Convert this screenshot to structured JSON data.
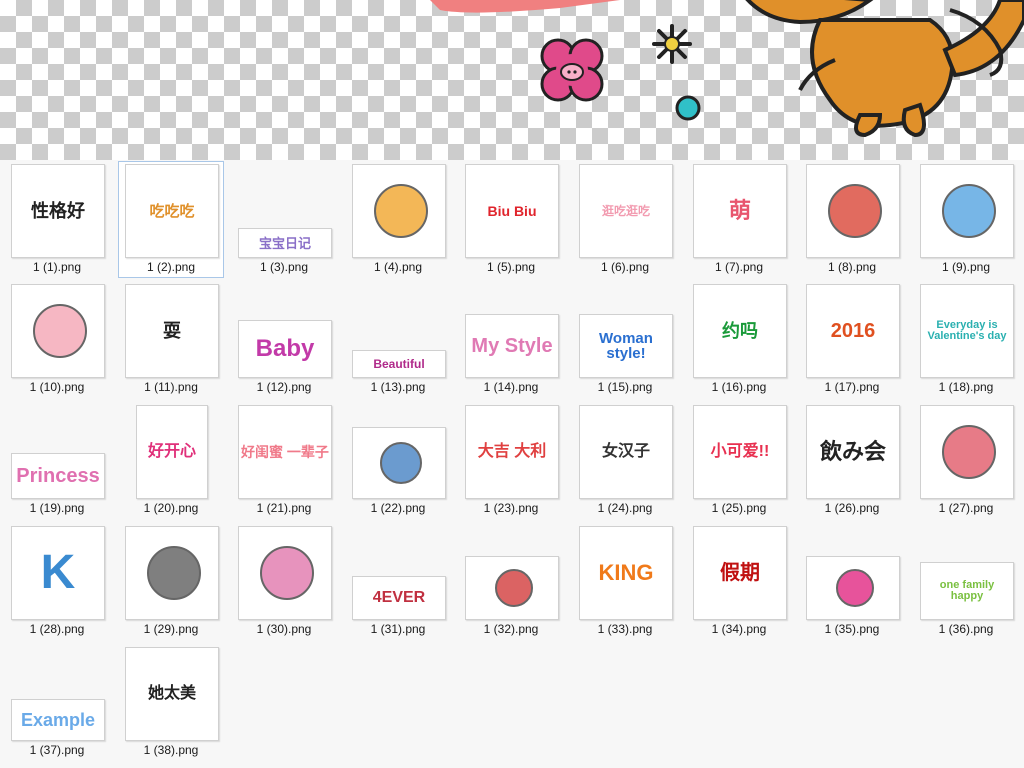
{
  "files": [
    {
      "name": "1 (1).png",
      "art": "性格好",
      "color": "#222222"
    },
    {
      "name": "1 (2).png",
      "art": "吃吃吃",
      "color": "#e0902a",
      "selected": true
    },
    {
      "name": "1 (3).png",
      "art": "宝宝日记",
      "color": "#8a6fc8"
    },
    {
      "name": "1 (4).png",
      "art": "",
      "color": "#f0a020"
    },
    {
      "name": "1 (5).png",
      "art": "Biu Biu",
      "color": "#e0242c"
    },
    {
      "name": "1 (6).png",
      "art": "逛吃逛吃",
      "color": "#f29bb0"
    },
    {
      "name": "1 (7).png",
      "art": "萌",
      "color": "#e8566e"
    },
    {
      "name": "1 (8).png",
      "art": "",
      "color": "#d83a2a"
    },
    {
      "name": "1 (9).png",
      "art": "",
      "color": "#4a9ee0"
    },
    {
      "name": "1 (10).png",
      "art": "",
      "color": "#f3a0b0"
    },
    {
      "name": "1 (11).png",
      "art": "耍",
      "color": "#222222"
    },
    {
      "name": "1 (12).png",
      "art": "Baby",
      "color": "#c23aa8"
    },
    {
      "name": "1 (13).png",
      "art": "Beautiful",
      "color": "#b02a8a"
    },
    {
      "name": "1 (14).png",
      "art": "My Style",
      "color": "#e07ab4"
    },
    {
      "name": "1 (15).png",
      "art": "Woman style!",
      "color": "#2a6fd0"
    },
    {
      "name": "1 (16).png",
      "art": "约吗",
      "color": "#1a9a3a"
    },
    {
      "name": "1 (17).png",
      "art": "2016",
      "color": "#e05020"
    },
    {
      "name": "1 (18).png",
      "art": "Everyday is Valentine's day",
      "color": "#2ab0b0"
    },
    {
      "name": "1 (19).png",
      "art": "Princess",
      "color": "#e070b0"
    },
    {
      "name": "1 (20).png",
      "art": "好开心",
      "color": "#e0307a"
    },
    {
      "name": "1 (21).png",
      "art": "好闺蜜 一辈子",
      "color": "#f07a8a"
    },
    {
      "name": "1 (22).png",
      "art": "",
      "color": "#3a7ac0"
    },
    {
      "name": "1 (23).png",
      "art": "大吉 大利",
      "color": "#e04040"
    },
    {
      "name": "1 (24).png",
      "art": "女汉子",
      "color": "#333333"
    },
    {
      "name": "1 (25).png",
      "art": "小可爱!!",
      "color": "#e83050"
    },
    {
      "name": "1 (26).png",
      "art": "飲み会",
      "color": "#222222"
    },
    {
      "name": "1 (27).png",
      "art": "",
      "color": "#e05060"
    },
    {
      "name": "1 (28).png",
      "art": "K",
      "color": "#3a8ad0"
    },
    {
      "name": "1 (29).png",
      "art": "",
      "color": "#555555"
    },
    {
      "name": "1 (30).png",
      "art": "",
      "color": "#e070a8"
    },
    {
      "name": "1 (31).png",
      "art": "4EVER",
      "color": "#c03040"
    },
    {
      "name": "1 (32).png",
      "art": "",
      "color": "#d03030"
    },
    {
      "name": "1 (33).png",
      "art": "KING",
      "color": "#f07a1a"
    },
    {
      "name": "1 (34).png",
      "art": "假期",
      "color": "#c01010"
    },
    {
      "name": "1 (35).png",
      "art": "",
      "color": "#e01a7a"
    },
    {
      "name": "1 (36).png",
      "art": "one family happy",
      "color": "#7ac040"
    },
    {
      "name": "1 (37).png",
      "art": "Example",
      "color": "#6aaae8"
    },
    {
      "name": "1 (38).png",
      "art": "她太美",
      "color": "#222222"
    }
  ],
  "colors": {
    "selection_border": "#a9c7e8",
    "grid_background": "#f7f7f7",
    "monkey": "#e0902a",
    "flower": "#e04a8a"
  }
}
